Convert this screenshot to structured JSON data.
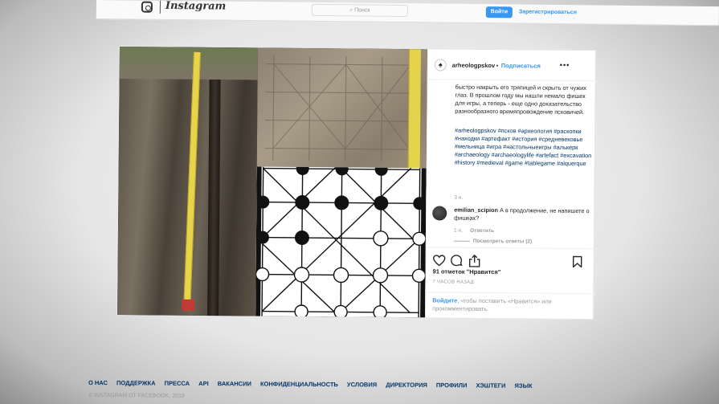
{
  "header": {
    "logo_text": "Instagram",
    "search_placeholder": "Поиск",
    "login_label": "Войти",
    "signup_label": "Зарегистрироваться"
  },
  "post": {
    "username": "arheologpskov",
    "separator": "•",
    "follow_label": "Подписаться",
    "caption": "быстро накрыть его тряпицей и скрыть от чужих глаз. В прошлом году мы нашли немало фишек для игры, а теперь - еще одно доказательство разнообразного времяпровождение псковичей.",
    "hashtags": "#arheologpskov #псков #археология #раскопки #находки #артефакт #история #средневековье #мельница #игра #настольныеигры #алькерк #archaeology #archaeologylife #artefact #excavation #history #medieval #game #tablegame #alquerque",
    "caption_time": "3 н.",
    "comment": {
      "user": "emilian_scipion",
      "text": "А в продолжение, не напишете о фишках?",
      "time": "1 н.",
      "reply_label": "Ответить",
      "view_replies": "Посмотреть ответы (2)"
    },
    "likes": "91 отметок \"Нравится\"",
    "post_time": "7 ЧАСОВ НАЗАД",
    "login_prompt_link": "Войдите",
    "login_prompt_text": ", чтобы поставить «Нравится» или прокомментировать."
  },
  "icons": {
    "heart": "heart-icon",
    "comment": "comment-icon",
    "share": "share-icon",
    "bookmark": "bookmark-icon",
    "more": "more-icon"
  },
  "footer": {
    "links": [
      "О НАС",
      "ПОДДЕРЖКА",
      "ПРЕССА",
      "API",
      "ВАКАНСИИ",
      "КОНФИДЕНЦИАЛЬНОСТЬ",
      "УСЛОВИЯ",
      "ДИРЕКТОРИЯ",
      "ПРОФИЛИ",
      "ХЭШТЕГИ",
      "ЯЗЫК"
    ],
    "copyright": "© INSTAGRAM ОТ FACEBOOK, 2019"
  },
  "colors": {
    "accent": "#3897f0",
    "link": "#003569",
    "muted": "#999999"
  }
}
